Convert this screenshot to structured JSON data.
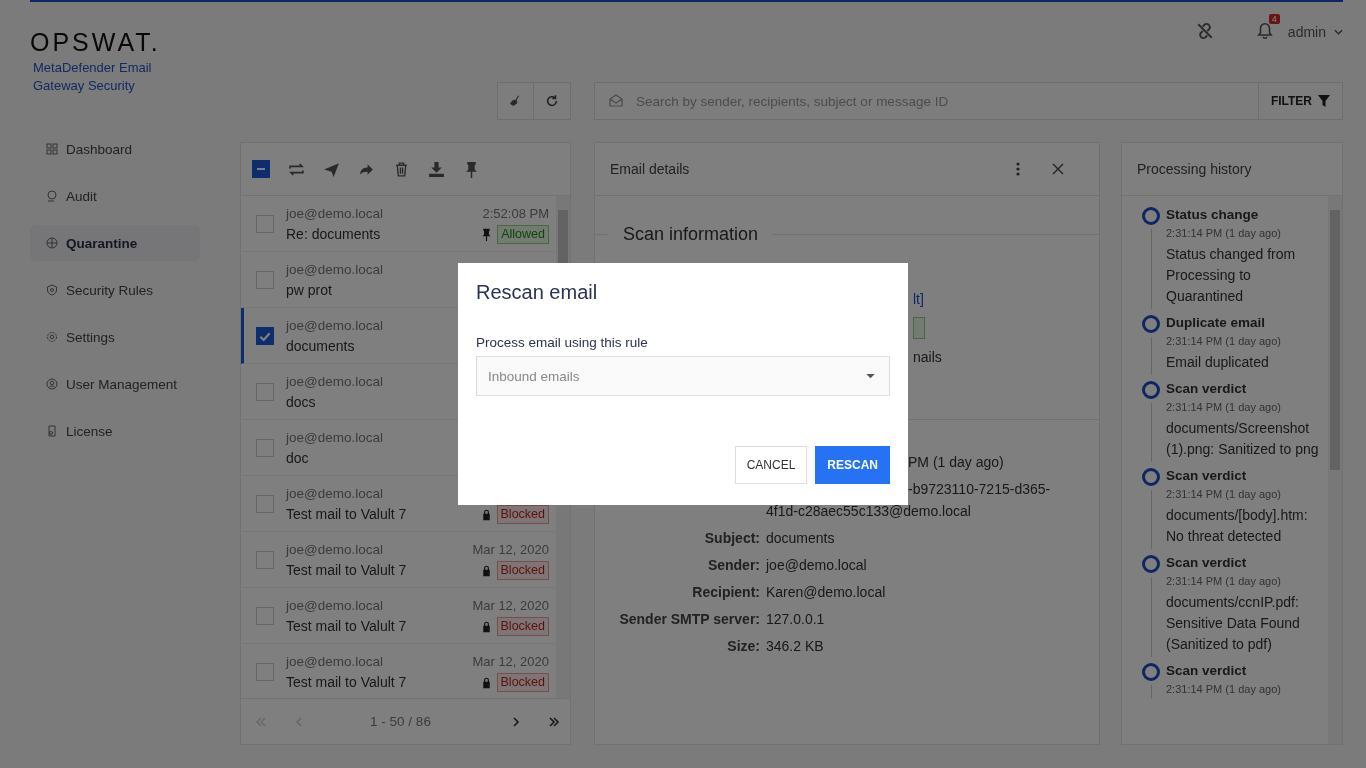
{
  "header": {
    "brand": "OPSWAT.",
    "product": "MetaDefender Email Gateway Security",
    "notifications": "4",
    "user": "admin"
  },
  "sidebar": {
    "items": [
      {
        "label": "Dashboard",
        "selected": false
      },
      {
        "label": "Audit",
        "selected": false
      },
      {
        "label": "Quarantine",
        "selected": true
      },
      {
        "label": "Security Rules",
        "selected": false
      },
      {
        "label": "Settings",
        "selected": false
      },
      {
        "label": "User Management",
        "selected": false
      },
      {
        "label": "License",
        "selected": false
      }
    ]
  },
  "search": {
    "placeholder": "Search by sender, recipients, subject or message ID",
    "filter": "FILTER"
  },
  "list": {
    "select_all_partial": true,
    "rows": [
      {
        "sender": "joe@demo.local",
        "subject": "Re: documents",
        "time": "2:52:08 PM",
        "pinned": true,
        "status": {
          "kind": "allowed",
          "label": "Allowed"
        },
        "checked": false,
        "selected": false
      },
      {
        "sender": "joe@demo.local",
        "subject": "pw prot",
        "checked": false,
        "selected": false
      },
      {
        "sender": "joe@demo.local",
        "subject": "documents",
        "checked": true,
        "selected": true
      },
      {
        "sender": "joe@demo.local",
        "subject": "docs",
        "checked": false,
        "selected": false
      },
      {
        "sender": "joe@demo.local",
        "subject": "doc",
        "checked": false,
        "selected": false
      },
      {
        "sender": "joe@demo.local",
        "subject": "Test mail to Valult 7",
        "locked": true,
        "status": {
          "kind": "blocked",
          "label": "Blocked"
        },
        "checked": false,
        "selected": false
      },
      {
        "sender": "joe@demo.local",
        "subject": "Test mail to Valult 7",
        "time": "Mar 12, 2020",
        "locked": true,
        "status": {
          "kind": "blocked",
          "label": "Blocked"
        },
        "checked": false,
        "selected": false
      },
      {
        "sender": "joe@demo.local",
        "subject": "Test mail to Valult 7",
        "time": "Mar 12, 2020",
        "locked": true,
        "status": {
          "kind": "blocked",
          "label": "Blocked"
        },
        "checked": false,
        "selected": false
      },
      {
        "sender": "joe@demo.local",
        "subject": "Test mail to Valult 7",
        "time": "Mar 12, 2020",
        "locked": true,
        "status": {
          "kind": "blocked",
          "label": "Blocked"
        },
        "checked": false,
        "selected": false
      }
    ],
    "pagination": "1 - 50 / 86"
  },
  "details": {
    "title": "Email details",
    "section": "Scan information",
    "fragments": [
      {
        "kind": "link",
        "text": "lt]"
      },
      {
        "kind": "badge"
      },
      {
        "kind": "text",
        "text": "nails"
      }
    ],
    "fields": [
      {
        "lines": [
          "PM (1 day ago)"
        ]
      },
      {
        "lines": [
          "-b9723110-7215-d365-",
          "4f1d-c28aec55c133@demo.local"
        ]
      },
      {
        "label": "Subject:",
        "lines": [
          "documents"
        ]
      },
      {
        "label": "Sender:",
        "lines": [
          "joe@demo.local"
        ]
      },
      {
        "label": "Recipient:",
        "lines": [
          "Karen@demo.local"
        ]
      },
      {
        "label": "Sender SMTP server:",
        "lines": [
          "127.0.0.1"
        ]
      },
      {
        "label": "Size:",
        "lines": [
          "346.2 KB"
        ]
      }
    ]
  },
  "history": {
    "title": "Processing history",
    "items": [
      {
        "title": "Status change",
        "time": "2:31:14 PM (1 day ago)",
        "text": "Status changed from Processing to Quarantined"
      },
      {
        "title": "Duplicate email",
        "time": "2:31:14 PM (1 day ago)",
        "text": "Email duplicated"
      },
      {
        "title": "Scan verdict",
        "time": "2:31:14 PM (1 day ago)",
        "text": "documents/Screenshot (1).png: Sanitized to png"
      },
      {
        "title": "Scan verdict",
        "time": "2:31:14 PM (1 day ago)",
        "text": "documents/[body].htm: No threat detected"
      },
      {
        "title": "Scan verdict",
        "time": "2:31:14 PM (1 day ago)",
        "text": "documents/ccnIP.pdf: Sensitive Data Found (Sanitized to pdf)"
      },
      {
        "title": "Scan verdict",
        "time": "2:31:14 PM (1 day ago)"
      }
    ]
  },
  "dialog": {
    "title": "Rescan email",
    "label": "Process email using this rule",
    "value": "Inbound emails",
    "buttons": [
      {
        "label": "CANCEL",
        "kind": "secondary"
      },
      {
        "label": "RESCAN",
        "kind": "primary"
      }
    ]
  }
}
